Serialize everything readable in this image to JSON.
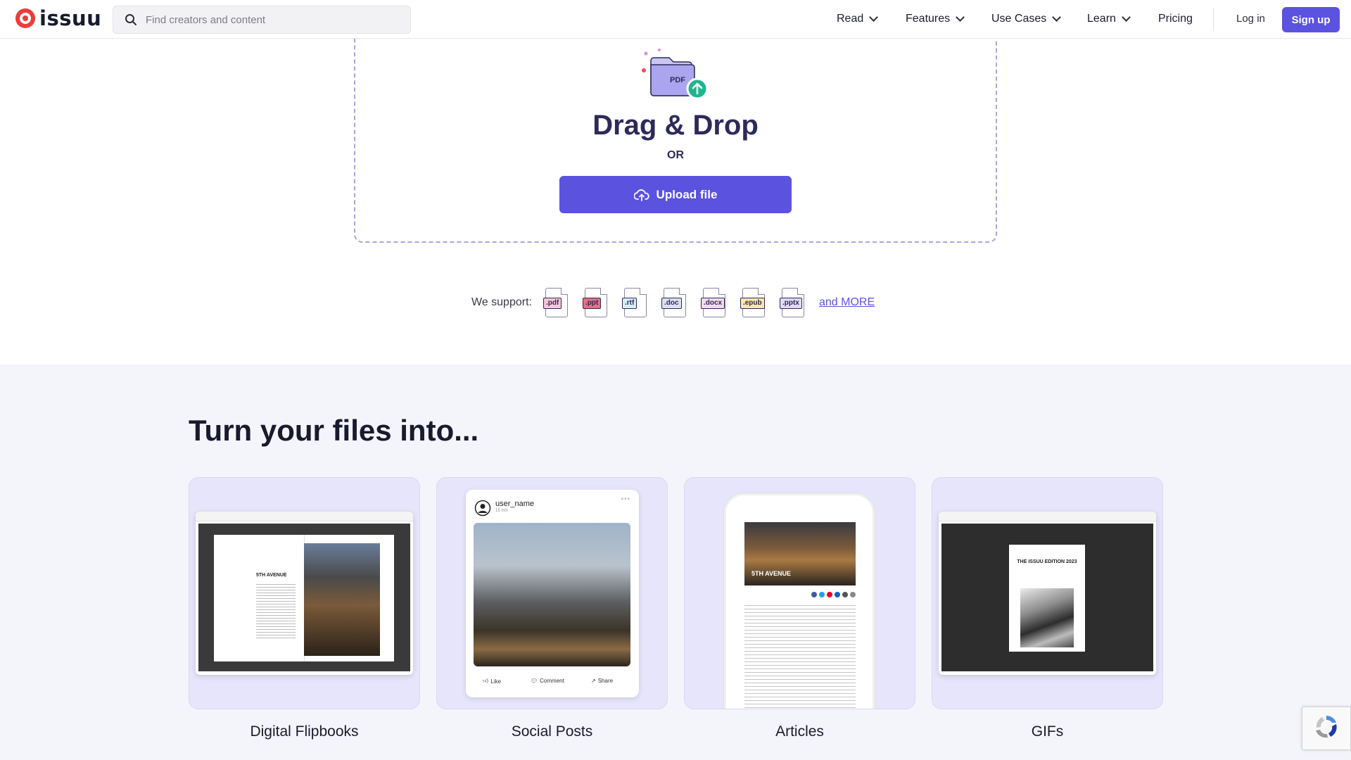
{
  "header": {
    "logo_text": "issuu",
    "search_placeholder": "Find creators and content",
    "nav": [
      {
        "label": "Read",
        "has_dropdown": true
      },
      {
        "label": "Features",
        "has_dropdown": true
      },
      {
        "label": "Use Cases",
        "has_dropdown": true
      },
      {
        "label": "Learn",
        "has_dropdown": true
      },
      {
        "label": "Pricing",
        "has_dropdown": false
      }
    ],
    "login_label": "Log in",
    "signup_label": "Sign up"
  },
  "upload": {
    "folder_label": "PDF",
    "title": "Drag & Drop",
    "or_label": "OR",
    "button_label": "Upload file"
  },
  "support": {
    "label": "We support:",
    "formats": [
      ".pdf",
      ".ppt",
      ".rtf",
      ".doc",
      ".docx",
      ".epub",
      ".pptx"
    ],
    "format_colors": [
      "#f8c8d4",
      "#e8707e",
      "#d8eef6",
      "#dde0f2",
      "#f3dbe8",
      "#fde7a6",
      "#e2d9f6"
    ],
    "more_label": "and MORE"
  },
  "turn_into": {
    "title": "Turn your files into...",
    "cards": [
      {
        "label": "Digital Flipbooks",
        "inner_text": "5TH AVENUE"
      },
      {
        "label": "Social Posts",
        "user": "user_name",
        "time": "15 min",
        "actions": [
          "Like",
          "Comment",
          "Share"
        ]
      },
      {
        "label": "Articles",
        "inner_text": "5TH AVENUE"
      },
      {
        "label": "GIFs",
        "inner_text": "THE ISSUU EDITION 2023"
      }
    ]
  },
  "colors": {
    "accent": "#5b52e0",
    "heading": "#2d2a5a",
    "section_bg": "#f4f4fb",
    "card_bg": "#e6e5fb"
  }
}
